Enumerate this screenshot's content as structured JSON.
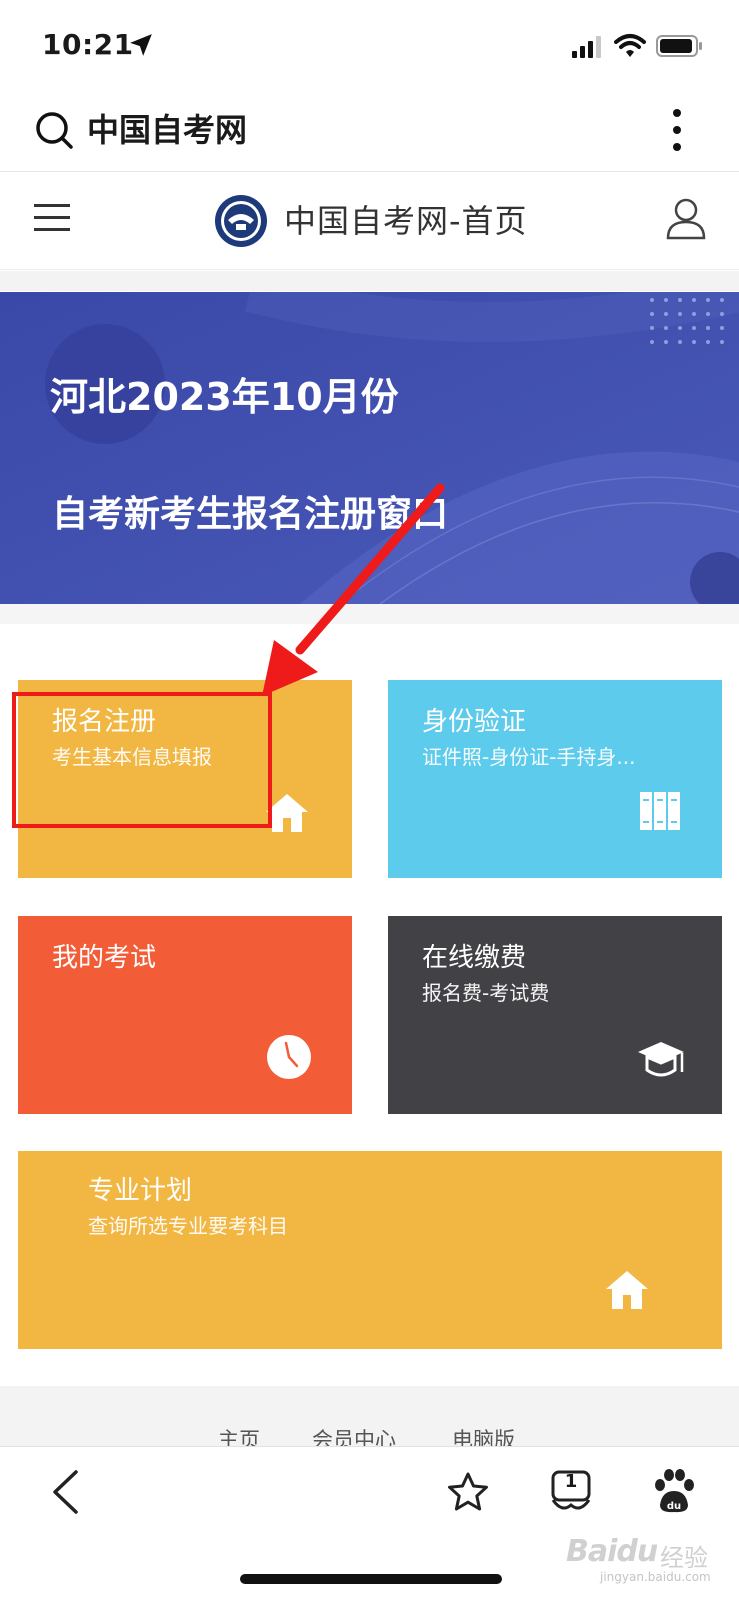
{
  "status_bar": {
    "time": "10:21"
  },
  "browser": {
    "query": "中国自考网"
  },
  "header": {
    "title": "中国自考网-首页"
  },
  "banner": {
    "line1": "河北2023年10月份",
    "line2": "自考新考生报名注册窗口",
    "bg_color": "#3f4ba9"
  },
  "tiles": [
    {
      "title": "报名注册",
      "subtitle": "考生基本信息填报",
      "icon": "home-icon",
      "color": "#f2b642"
    },
    {
      "title": "身份验证",
      "subtitle": "证件照-身份证-手持身...",
      "icon": "book-icon",
      "color": "#5ccbec"
    },
    {
      "title": "我的考试",
      "subtitle": "",
      "icon": "clock-icon",
      "color": "#f25d37"
    },
    {
      "title": "在线缴费",
      "subtitle": "报名费-考试费",
      "icon": "graduation-cap-icon",
      "color": "#424246"
    },
    {
      "title": "专业计划",
      "subtitle": "查询所选专业要考科目",
      "icon": "home-icon",
      "color": "#f2b642"
    }
  ],
  "footer_links": [
    "主页",
    "会员中心",
    "电脑版"
  ],
  "toolbar": {
    "tab_count": "1"
  },
  "watermark": {
    "brand": "Baidu",
    "cn": "经验",
    "url": "jingyan.baidu.com"
  },
  "annotation": {
    "color": "#ef1a1a"
  }
}
